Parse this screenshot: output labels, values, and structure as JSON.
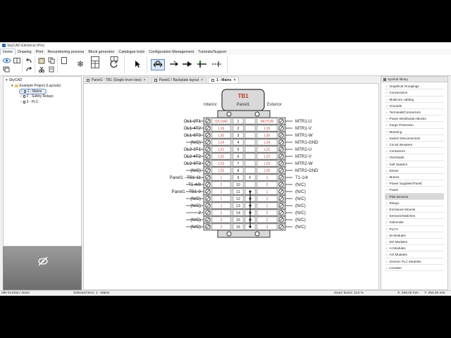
{
  "window": {
    "title": "SkyCAD Electrical (Pro)"
  },
  "menu": [
    "Home",
    "Drawing",
    "Print",
    "Renumbering process",
    "Block generator",
    "Catalogue tools",
    "Configuration Management",
    "Tutorials/Support"
  ],
  "toolbar_icons": [
    "eye-icon",
    "layers-icon",
    "undo-icon",
    "redo-icon",
    "cut-icon",
    "copy-icon",
    "paste-icon",
    "clipboard-icon",
    "snowflake-icon",
    "table-icon",
    "refresh-icon",
    "pointer-icon",
    "move-icon",
    "wire-add-icon",
    "arrow-icon",
    "wire-end-icon",
    "wire-dots-icon"
  ],
  "tree": {
    "root": "SkyCAD",
    "project": "Example Project (Layouts)",
    "children": [
      "1 - Mains",
      "2 - Safety Relays",
      "3 - PLC"
    ]
  },
  "tabs": [
    {
      "label": "Panel1 - TB1 (Single level view)",
      "close": "×"
    },
    {
      "label": "Panel1 / Backplate layout",
      "close": "×"
    },
    {
      "label": "1 - Mains",
      "close": "×"
    }
  ],
  "terminal_block": {
    "name": "TB1",
    "panel": "Panel1",
    "interior": "Interior",
    "exterior": "Exterior",
    "rows": [
      {
        "left": "OL1-2T1",
        "l1": "O/LOAD",
        "num": "1",
        "c": "",
        "r1": "MOTOR",
        "right": "MTR1-U"
      },
      {
        "left": "OL1-4T2",
        "l1": "L19",
        "num": "2",
        "c": "",
        "r1": "L19",
        "right": "MTR1-V"
      },
      {
        "left": "OL1-6T3",
        "l1": "L20",
        "num": "3",
        "c": "",
        "r1": "L20",
        "right": "MTR1-W"
      },
      {
        "left": "(N/C)",
        "l1": "L24",
        "num": "4",
        "c": "",
        "r1": "L24",
        "right": "MTR1-GND"
      },
      {
        "left": "OL2-2T1",
        "l1": "L21",
        "num": "5",
        "c": "",
        "r1": "L21",
        "right": "MTR2-U"
      },
      {
        "left": "OL2-4T2",
        "l1": "L22",
        "num": "6",
        "c": "",
        "r1": "L22",
        "right": "MTR2-V"
      },
      {
        "left": "OL2-6T3",
        "l1": "L23",
        "num": "7",
        "c": "",
        "r1": "L23",
        "right": "MTR2-W"
      },
      {
        "left": "(N/C)",
        "l1": "L25",
        "num": "8",
        "c": "",
        "r1": "L25",
        "right": "MTR2-GND"
      },
      {
        "left": "Panel1 - TB1-11",
        "l1": "1",
        "num": "9",
        "c": "F",
        "r1": "1",
        "right": "T1-1/4"
      },
      {
        "left": "T1-4/8",
        "l1": "2",
        "num": "10",
        "c": "",
        "r1": "2",
        "right": "(N/C)"
      },
      {
        "left": "Panel1 - TB1-9",
        "l1": "1",
        "num": "11",
        "c": "",
        "r1": "1",
        "right": "(N/C)"
      },
      {
        "left": "(N/C)",
        "l1": "1",
        "num": "12",
        "c": "",
        "r1": "1",
        "right": "(N/C)"
      },
      {
        "left": "(N/C)",
        "l1": "1",
        "num": "13",
        "c": "",
        "r1": "1",
        "right": "(N/C)"
      },
      {
        "left": "2",
        "l1": "2",
        "num": "14",
        "c": "",
        "r1": "2",
        "right": "(N/C)"
      },
      {
        "left": "(N/C)",
        "l1": "2",
        "num": "15",
        "c": "",
        "r1": "2",
        "right": "(N/C)"
      },
      {
        "left": "(N/C)",
        "l1": "2",
        "num": "16",
        "c": "",
        "r1": "2",
        "right": "(N/C)"
      }
    ]
  },
  "library": {
    "title": "Symbol library",
    "items": [
      "Graphical Groupings",
      "Connections",
      "Multicore cabling",
      "Grounds",
      "Terminals/Connectors",
      "Power Distribution Blocks",
      "Surge Protection",
      "Metering",
      "Switch Disconnectors",
      "Circuit Breakers",
      "Contactors",
      "Overloads",
      "Soft Starters",
      "Drives",
      "Motors",
      "Power Supplies/Transf.",
      "Fuses",
      "Pilot Devices",
      "Relays",
      "Enclosure Mounts",
      "Sensors/Switches",
      "Solenoids",
      "PLC's",
      "DI Modules",
      "DO Modules",
      "AI Modules",
      "AO Modules",
      "Generic PLC Modules",
      "Location"
    ],
    "active_index": 17
  },
  "status": {
    "function": "Idle function: None",
    "selected": "Selected item: 1 - Mains",
    "zoom": "Zoom factor: 214 %",
    "x": "X: 268,00 mm",
    "y": "Y: 252,00 mm"
  },
  "colors": {
    "accent": "#2b6cb0",
    "wire_label": "#c0504d",
    "block_fill": "#d9d9d9"
  }
}
